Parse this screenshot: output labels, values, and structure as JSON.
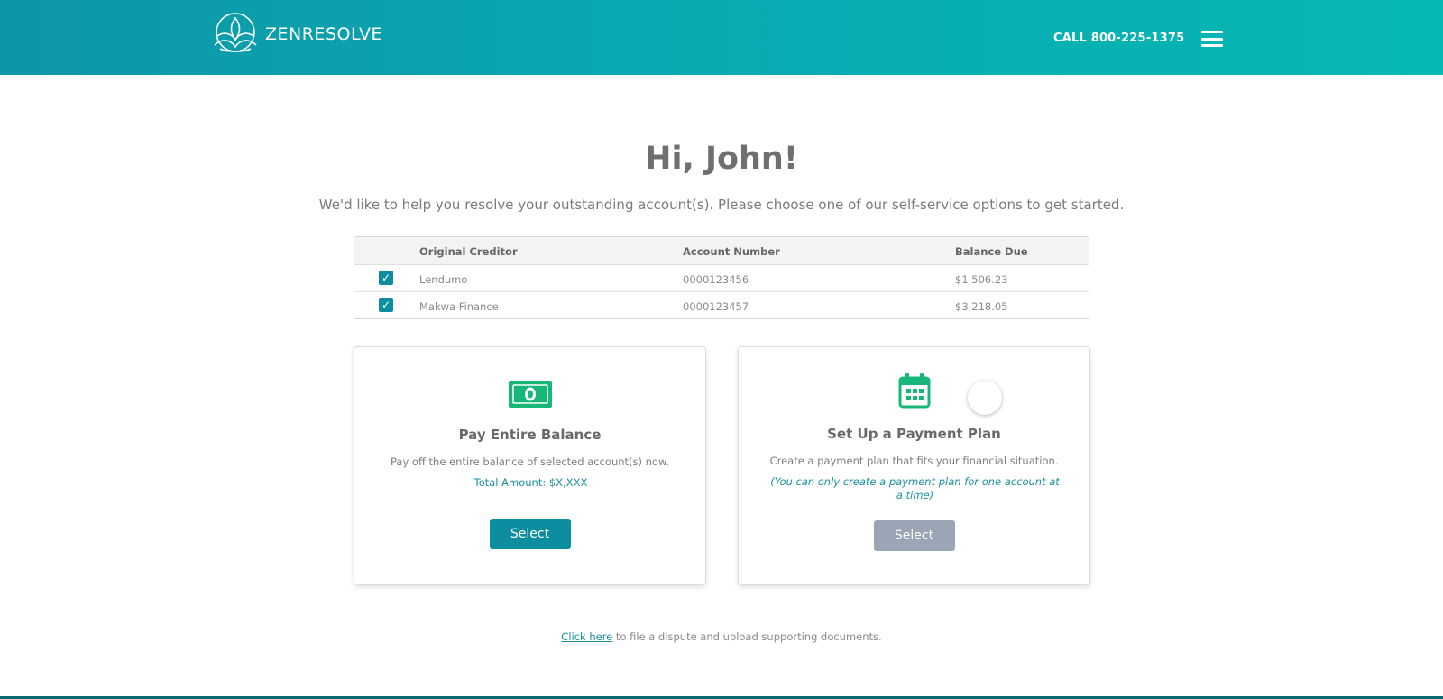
{
  "header": {
    "logo_text": "ZENRESOLVE",
    "call_text": "CALL 800-225-1375",
    "gradient": [
      "#0c96a6",
      "#05b8b3"
    ]
  },
  "main": {
    "greeting": "Hi, John!",
    "intro": "We'd like to help you resolve your outstanding account(s). Please choose one of our self-service options to get started."
  },
  "accounts": {
    "headers": {
      "creditor": "Original Creditor",
      "account": "Account Number",
      "balance": "Balance Due"
    },
    "rows": [
      {
        "checked": true,
        "creditor": "Lendumo",
        "account": "0000123456",
        "balance": "$1,506.23"
      },
      {
        "checked": true,
        "creditor": "Makwa Finance",
        "account": "0000123457",
        "balance": "$3,218.05"
      }
    ]
  },
  "options": {
    "pay_full": {
      "icon": "cash-icon",
      "title": "Pay Entire Balance",
      "description": "Pay off the entire balance of  selected account(s) now.",
      "total": "Total Amount: $X,XXX",
      "button": "Select"
    },
    "payment_plan": {
      "icon": "calendar-icon",
      "title": "Set Up a Payment Plan",
      "description": "Create a payment plan that fits your financial situation.",
      "note": "(You can only create a payment plan for one account at a time)",
      "button": "Select"
    }
  },
  "footer": {
    "link_text": "Click here",
    "rest_text": " to file a dispute and upload supporting documents."
  },
  "colors": {
    "accent": "#0d8ea0",
    "icon_green": "#17b77a",
    "disabled_button": "#9aa5b6"
  }
}
